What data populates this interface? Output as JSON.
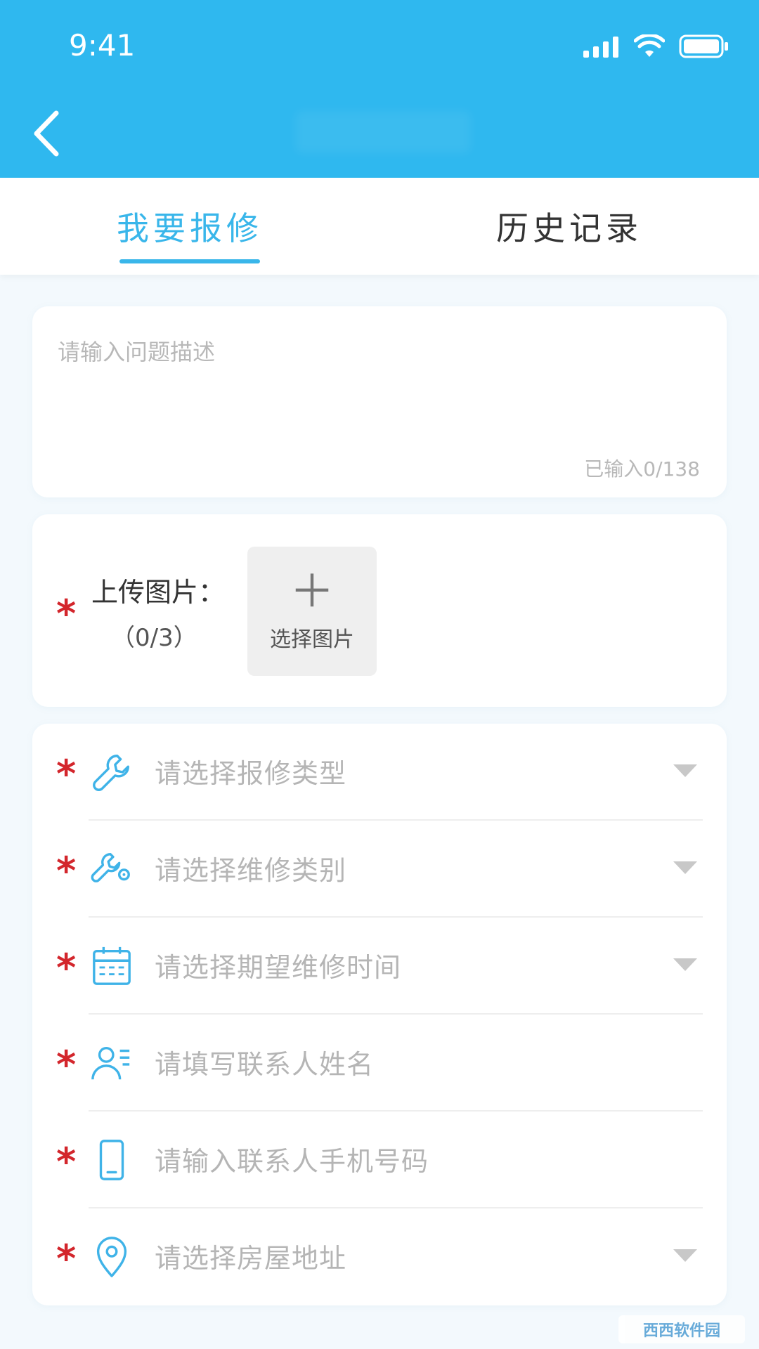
{
  "status_bar": {
    "time": "9:41"
  },
  "tabs": [
    {
      "label": "我要报修",
      "active": true
    },
    {
      "label": "历史记录",
      "active": false
    }
  ],
  "description": {
    "placeholder": "请输入问题描述",
    "count": "已输入0/138"
  },
  "upload": {
    "label": "上传图片：",
    "count": "（0/3）",
    "pick_label": "选择图片",
    "required": "*"
  },
  "form_rows": [
    {
      "icon": "wrench-icon",
      "text": "请选择报修类型",
      "dropdown": true,
      "required": "*"
    },
    {
      "icon": "wrench-gear-icon",
      "text": "请选择维修类别",
      "dropdown": true,
      "required": "*"
    },
    {
      "icon": "calendar-icon",
      "text": "请选择期望维修时间",
      "dropdown": true,
      "required": "*"
    },
    {
      "icon": "contact-person-icon",
      "text": "请填写联系人姓名",
      "dropdown": false,
      "required": "*"
    },
    {
      "icon": "mobile-phone-icon",
      "text": "请输入联系人手机号码",
      "dropdown": false,
      "required": "*"
    },
    {
      "icon": "location-pin-icon",
      "text": "请选择房屋地址",
      "dropdown": true,
      "required": "*"
    }
  ],
  "watermark": "西西软件园",
  "colors": {
    "header": "#2fb8ef",
    "accent": "#39b6ea",
    "required": "#d3262c"
  }
}
